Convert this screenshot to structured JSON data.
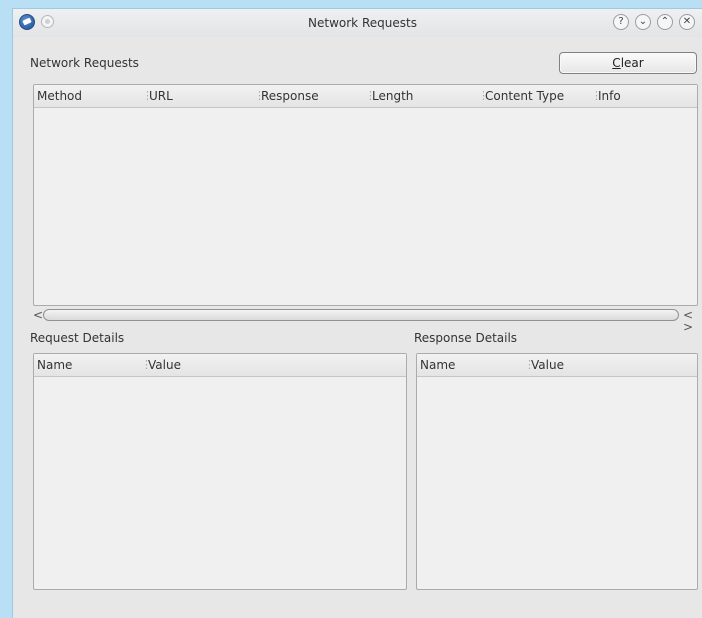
{
  "window": {
    "title": "Network Requests"
  },
  "titlebar_buttons": [
    {
      "name": "help",
      "glyph": "?"
    },
    {
      "name": "minimize",
      "glyph": "⌄"
    },
    {
      "name": "maximize",
      "glyph": "⌃"
    },
    {
      "name": "close",
      "glyph": "✕"
    }
  ],
  "requests": {
    "label": "Network Requests",
    "clear_prefix": "C",
    "clear_rest": "lear",
    "columns": [
      "Method",
      "URL",
      "Response",
      "Length",
      "Content Type",
      "Info"
    ],
    "rows": []
  },
  "scrollbar": {
    "left_arrow": "<",
    "right_arrows": "< >"
  },
  "request_details": {
    "label": "Request Details",
    "columns": [
      "Name",
      "Value"
    ],
    "rows": []
  },
  "response_details": {
    "label": "Response Details",
    "columns": [
      "Name",
      "Value"
    ],
    "rows": []
  }
}
